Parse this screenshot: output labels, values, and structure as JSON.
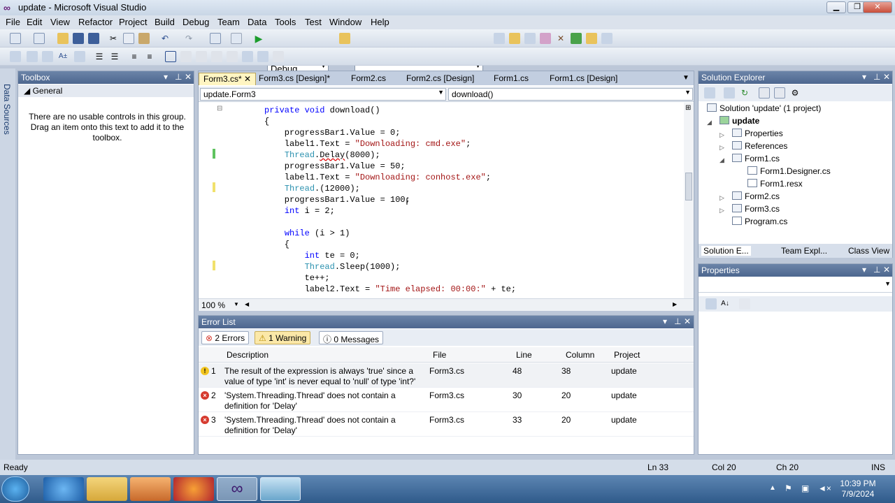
{
  "window": {
    "title": "update - Microsoft Visual Studio",
    "min": "▁",
    "max": "❐",
    "close": "✕"
  },
  "menu": [
    "File",
    "Edit",
    "View",
    "Refactor",
    "Project",
    "Build",
    "Debug",
    "Team",
    "Data",
    "Tools",
    "Test",
    "Window",
    "Help"
  ],
  "toolbar": {
    "config": "Debug",
    "platform": ""
  },
  "side_strip": {
    "label": "Data Sources"
  },
  "toolbox": {
    "title": "Toolbox",
    "group": "General",
    "message": "There are no usable controls in this group. Drag an item onto this text to add it to the toolbox."
  },
  "editor": {
    "tabs": [
      "Form3.cs*",
      "Form3.cs [Design]*",
      "Form2.cs",
      "Form2.cs [Design]",
      "Form1.cs",
      "Form1.cs [Design]"
    ],
    "nav_left": "update.Form3",
    "nav_right": "download()",
    "zoom": "100 %",
    "code_lines": [
      "private void download()",
      "{",
      "    progressBar1.Value = 0;",
      "    label1.Text = \"Downloading: cmd.exe\";",
      "    Thread.Delay(8000);",
      "    progressBar1.Value = 50;",
      "    label1.Text = \"Downloading: conhost.exe\";",
      "    Thread.(12000);",
      "    progressBar1.Value = 100;",
      "    int i = 2;",
      "",
      "    while (i > 1)",
      "    {",
      "        int te = 0;",
      "        Thread.Sleep(1000);",
      "        te++;",
      "        label2.Text = \"Time elapsed: 00:00:\" + te;",
      "    }"
    ]
  },
  "error_list": {
    "title": "Error List",
    "filters": {
      "errors": "2 Errors",
      "warnings": "1 Warning",
      "messages": "0 Messages"
    },
    "columns": [
      "Description",
      "File",
      "Line",
      "Column",
      "Project"
    ],
    "rows": [
      {
        "n": "1",
        "type": "warning",
        "desc": "The result of the expression is always 'true' since a value of type 'int' is never equal to 'null' of type 'int?'",
        "file": "Form3.cs",
        "line": "48",
        "col": "38",
        "project": "update"
      },
      {
        "n": "2",
        "type": "error",
        "desc": "'System.Threading.Thread' does not contain a definition for 'Delay'",
        "file": "Form3.cs",
        "line": "30",
        "col": "20",
        "project": "update"
      },
      {
        "n": "3",
        "type": "error",
        "desc": "'System.Threading.Thread' does not contain a definition for 'Delay'",
        "file": "Form3.cs",
        "line": "33",
        "col": "20",
        "project": "update"
      }
    ]
  },
  "solution_explorer": {
    "title": "Solution Explorer",
    "solution": "Solution 'update' (1 project)",
    "project": "update",
    "items": [
      "Properties",
      "References",
      "Form1.cs",
      "Form1.Designer.cs",
      "Form1.resx",
      "Form2.cs",
      "Form3.cs",
      "Program.cs"
    ],
    "tabs": [
      "Solution E...",
      "Team Expl...",
      "Class View"
    ]
  },
  "properties": {
    "title": "Properties"
  },
  "status": {
    "left": "Ready",
    "ln": "Ln 33",
    "col": "Col 20",
    "ch": "Ch 20",
    "mode": "INS"
  },
  "taskbar": {
    "time": "10:39 PM",
    "date": "7/9/2024"
  },
  "colors": {
    "pane_header": "#4d678f",
    "active_tab": "#fff5c2",
    "error": "#d63b2f",
    "warning": "#f2c521"
  }
}
